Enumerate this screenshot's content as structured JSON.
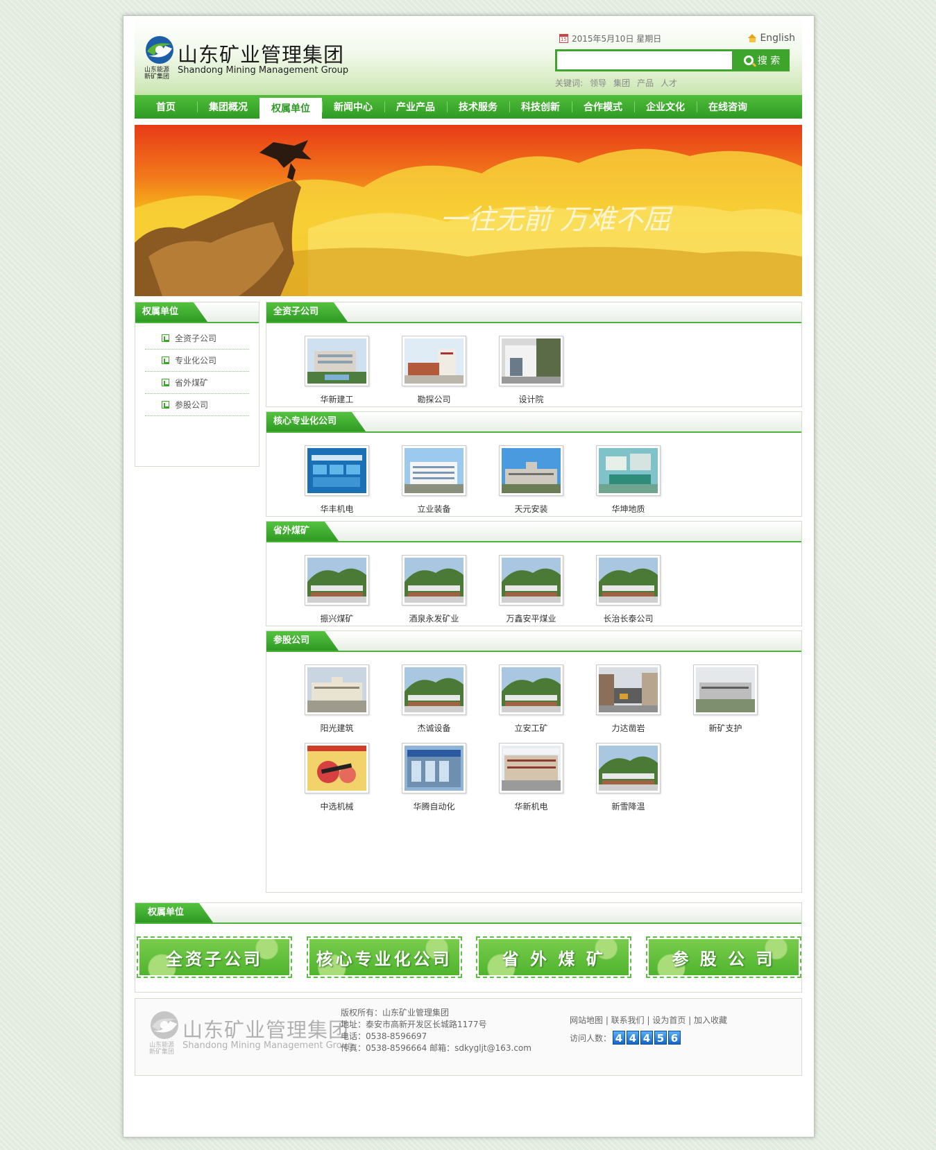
{
  "header": {
    "logo_cn": "山东矿业管理集团",
    "logo_en": "Shandong Mining Management Group",
    "logo_sub": "山东能源新矿集团",
    "date": "2015年5月10日 星期日",
    "calendar_day": "15",
    "english_link": "English",
    "search_button": "搜 索",
    "search_placeholder": "",
    "keywords_label": "关键词:",
    "keywords": [
      "领导",
      "集团",
      "产品",
      "人才"
    ]
  },
  "nav": [
    "首页",
    "集团概况",
    "权属单位",
    "新闻中心",
    "产业产品",
    "技术服务",
    "科技创新",
    "合作模式",
    "企业文化",
    "在线咨询"
  ],
  "nav_active_index": 2,
  "banner": {
    "slogan": "一往无前  万难不屈"
  },
  "sidebar": {
    "title": "权属单位",
    "items": [
      "全资子公司",
      "专业化公司",
      "省外煤矿",
      "参股公司"
    ]
  },
  "sections": [
    {
      "title": "全资子公司",
      "units": [
        {
          "name": "华新建工",
          "icon": "building-photo"
        },
        {
          "name": "勘探公司",
          "icon": "building-photo"
        },
        {
          "name": "设计院",
          "icon": "building-photo"
        }
      ]
    },
    {
      "title": "核心专业化公司",
      "units": [
        {
          "name": "华丰机电",
          "icon": "screen-photo"
        },
        {
          "name": "立业装备",
          "icon": "building-photo"
        },
        {
          "name": "天元安装",
          "icon": "building-photo"
        },
        {
          "name": "华坤地质",
          "icon": "building-photo"
        }
      ]
    },
    {
      "title": "省外煤矿",
      "units": [
        {
          "name": "振兴煤矿",
          "icon": "mine-photo"
        },
        {
          "name": "酒泉永发矿业",
          "icon": "mine-photo"
        },
        {
          "name": "万鑫安平煤业",
          "icon": "mine-photo"
        },
        {
          "name": "长治长泰公司",
          "icon": "mine-photo"
        }
      ]
    },
    {
      "title": "参股公司",
      "units": [
        {
          "name": "阳光建筑",
          "icon": "building-photo"
        },
        {
          "name": "杰诚设备",
          "icon": "mine-photo"
        },
        {
          "name": "立安工矿",
          "icon": "mine-photo"
        },
        {
          "name": "力达凿岩",
          "icon": "building-photo"
        },
        {
          "name": "新矿支护",
          "icon": "building-photo"
        },
        {
          "name": "中选机械",
          "icon": "product-photo"
        },
        {
          "name": "华腾自动化",
          "icon": "building-photo"
        },
        {
          "name": "华新机电",
          "icon": "building-photo"
        },
        {
          "name": "新雪降温",
          "icon": "mine-photo"
        }
      ]
    }
  ],
  "links_box": {
    "title": "权属单位",
    "buttons": [
      "全资子公司",
      "核心专业化公司",
      "省 外 煤 矿",
      "参 股 公 司"
    ]
  },
  "footer": {
    "copyright": "版权所有：山东矿业管理集团",
    "address": "地址：泰安市高新开发区长城路1177号",
    "phone": "电话：0538-8596697",
    "fax": "传真：0538-8596664 邮箱：sdkygljt@163.com",
    "links": "网站地图 | 联系我们 | 设为首页 | 加入收藏",
    "visit_label": "访问人数：",
    "visit_digits": [
      "4",
      "4",
      "4",
      "5",
      "6"
    ]
  },
  "colors": {
    "brand_green": "#3da52c",
    "nav_green": "#2f9a24",
    "counter_blue": "#1566c9"
  }
}
